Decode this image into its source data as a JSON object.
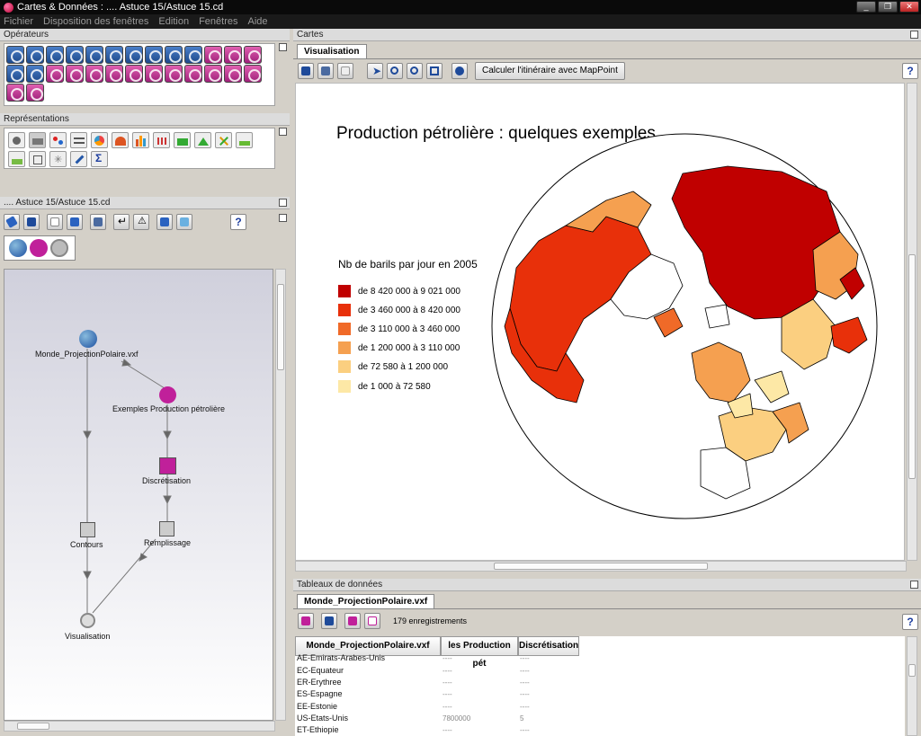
{
  "window": {
    "title": "Cartes & Données : .... Astuce 15/Astuce 15.cd",
    "controls": [
      "_",
      "❐",
      "✕"
    ]
  },
  "menu": [
    "Fichier",
    "Disposition des fenêtres",
    "Edition",
    "Fenêtres",
    "Aide"
  ],
  "panels": {
    "operateurs": "Opérateurs",
    "representations": "Représentations",
    "document": ".... Astuce 15/Astuce 15.cd",
    "cartes": "Cartes",
    "tableaux": "Tableaux de données"
  },
  "flow": {
    "nodes": [
      {
        "label": "Monde_ProjectionPolaire.vxf"
      },
      {
        "label": "Exemples Production pétrolière"
      },
      {
        "label": "Discrétisation"
      },
      {
        "label": "Contours"
      },
      {
        "label": "Remplissage"
      },
      {
        "label": "Visualisation"
      }
    ]
  },
  "cartes": {
    "tab": "Visualisation",
    "mappoint_button": "Calculer l'itinéraire avec MapPoint",
    "help": "?",
    "map_title": "Production pétrolière : quelques exemples",
    "legend_title": "Nb de barils par jour en 2005",
    "legend": [
      {
        "label": "de 8 420 000 à 9 021 000",
        "color": "#c00000"
      },
      {
        "label": "de 3 460 000 à 8 420 000",
        "color": "#e8300a"
      },
      {
        "label": "de 3 110 000 à 3 460 000",
        "color": "#f06a28"
      },
      {
        "label": "de 1 200 000 à 3 110 000",
        "color": "#f5a050"
      },
      {
        "label": "de 72 580 à 1 200 000",
        "color": "#fbcf80"
      },
      {
        "label": "de 1 000 à 72 580",
        "color": "#fde8a6"
      }
    ]
  },
  "tableaux": {
    "tab": "Monde_ProjectionPolaire.vxf",
    "count": "179 enregistrements",
    "help": "?",
    "columns": [
      "Monde_ProjectionPolaire.vxf",
      "les Production pét",
      "Discrétisation"
    ],
    "rows": [
      {
        "name": "AE-Emirats-Arabes-Unis",
        "prod": "----",
        "disc": "----"
      },
      {
        "name": "EC-Equateur",
        "prod": "----",
        "disc": "----"
      },
      {
        "name": "ER-Erythree",
        "prod": "----",
        "disc": "----"
      },
      {
        "name": "ES-Espagne",
        "prod": "----",
        "disc": "----"
      },
      {
        "name": "EE-Estonie",
        "prod": "----",
        "disc": "----"
      },
      {
        "name": "US-Etats-Unis",
        "prod": "7800000",
        "disc": "5"
      },
      {
        "name": "ET-Ethiopie",
        "prod": "----",
        "disc": "----"
      }
    ]
  },
  "doc_help": "?"
}
